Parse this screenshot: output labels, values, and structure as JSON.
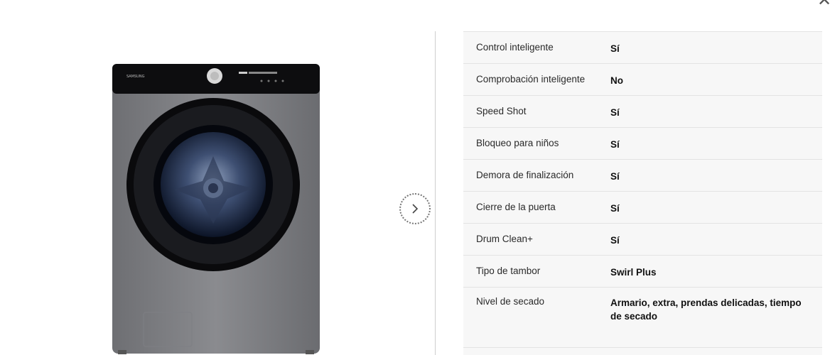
{
  "icons": {
    "close": "close-icon",
    "next": "chevron-right-icon"
  },
  "product_image": {
    "brand_text": "SAMSUNG",
    "alt": "Samsung front-load washer, inox finish"
  },
  "specs": [
    {
      "label": "Control inteligente",
      "value": "Sí"
    },
    {
      "label": "Comprobación inteligente",
      "value": "No"
    },
    {
      "label": "Speed Shot",
      "value": "Sí"
    },
    {
      "label": "Bloqueo para niños",
      "value": "Sí"
    },
    {
      "label": "Demora de finalización",
      "value": "Sí"
    },
    {
      "label": "Cierre de la puerta",
      "value": "Sí"
    },
    {
      "label": "Drum Clean+",
      "value": "Sí"
    },
    {
      "label": "Tipo de tambor",
      "value": "Swirl Plus"
    },
    {
      "label": "Nivel de secado",
      "value": "Armario, extra, prendas delicadas, tiempo de secado"
    }
  ]
}
